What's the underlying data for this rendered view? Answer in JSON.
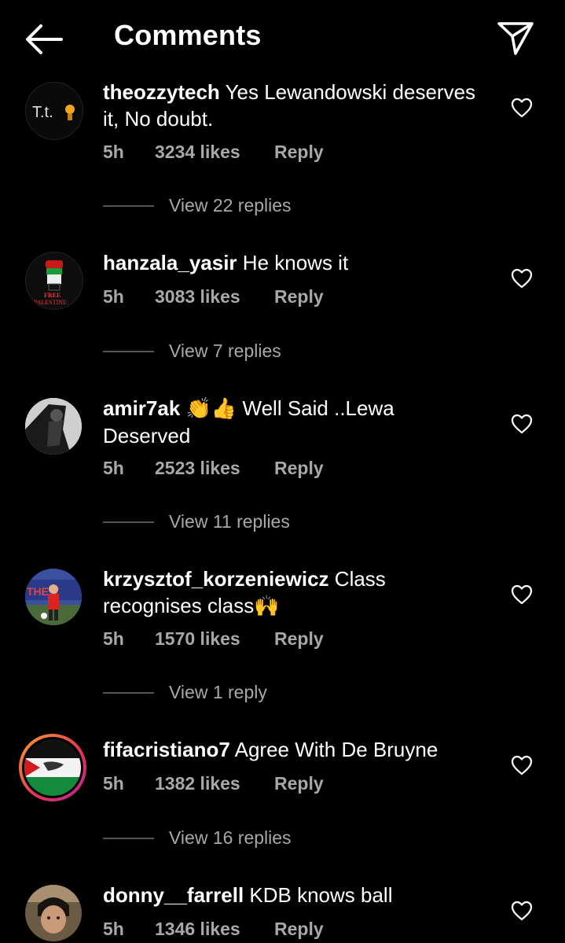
{
  "header": {
    "title": "Comments"
  },
  "comments": [
    {
      "username": "theozzytech",
      "text": "Yes Lewandowski deserves it, No doubt.",
      "time": "5h",
      "likes": "3234 likes",
      "reply": "Reply",
      "view_replies": "View 22 replies",
      "avatar_text": "T.t."
    },
    {
      "username": "hanzala_yasir",
      "text": "He knows it",
      "time": "5h",
      "likes": "3083 likes",
      "reply": "Reply",
      "view_replies": "View 7 replies",
      "avatar_text": "FREE PALESTINE"
    },
    {
      "username": "amir7ak",
      "emoji": "👏👍",
      "text": "Well Said ..Lewa Deserved",
      "time": "5h",
      "likes": "2523 likes",
      "reply": "Reply",
      "view_replies": "View 11 replies"
    },
    {
      "username": "krzysztof_korzeniewicz",
      "text": "Class recognises class",
      "emoji": "🙌",
      "time": "5h",
      "likes": "1570 likes",
      "reply": "Reply",
      "view_replies": "View 1 reply"
    },
    {
      "username": "fifacristiano7",
      "text": "Agree With De Bruyne",
      "time": "5h",
      "likes": "1382 likes",
      "reply": "Reply",
      "view_replies": "View 16 replies"
    },
    {
      "username": "donny__farrell",
      "text": "KDB knows ball",
      "time": "5h",
      "likes": "1346 likes",
      "reply": "Reply"
    }
  ],
  "icons": {
    "back": "arrow-left-icon",
    "share": "paper-plane-icon",
    "like": "heart-outline-icon"
  },
  "colors": {
    "background": "#000000",
    "text_primary": "#ffffff",
    "text_secondary": "#a8a8a8"
  }
}
